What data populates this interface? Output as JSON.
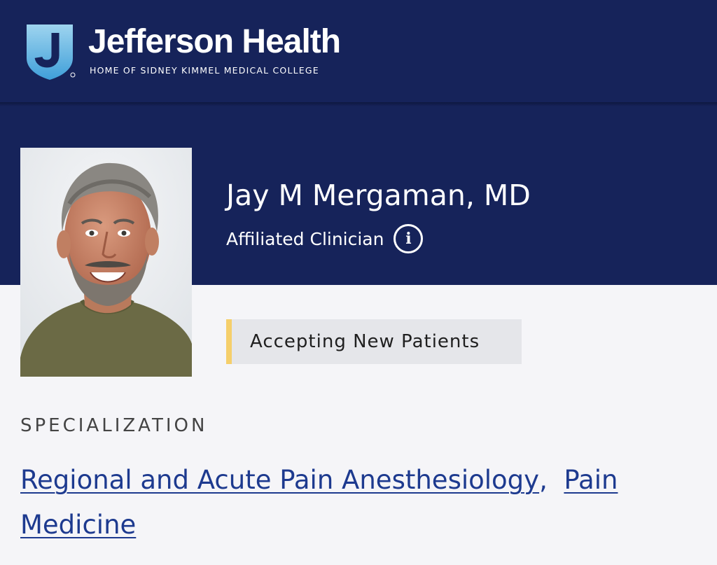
{
  "header": {
    "brand_name": "Jefferson Health",
    "tagline": "HOME OF SIDNEY KIMMEL MEDICAL COLLEGE",
    "logo_icon": "jefferson-shield-icon",
    "background_color": "#16235a"
  },
  "profile": {
    "name": "Jay M Mergaman, MD",
    "affiliation": "Affiliated Clinician",
    "info_icon_glyph": "i",
    "info_icon": "info-icon",
    "status_badge": "Accepting New Patients",
    "status_accent_color": "#f5cf6b"
  },
  "specialization": {
    "heading": "SPECIALIZATION",
    "separator": ",",
    "items": [
      {
        "label": "Regional and Acute Pain Anesthesiology"
      },
      {
        "label": "Pain Medicine"
      }
    ],
    "link_color": "#1d3a8f"
  }
}
